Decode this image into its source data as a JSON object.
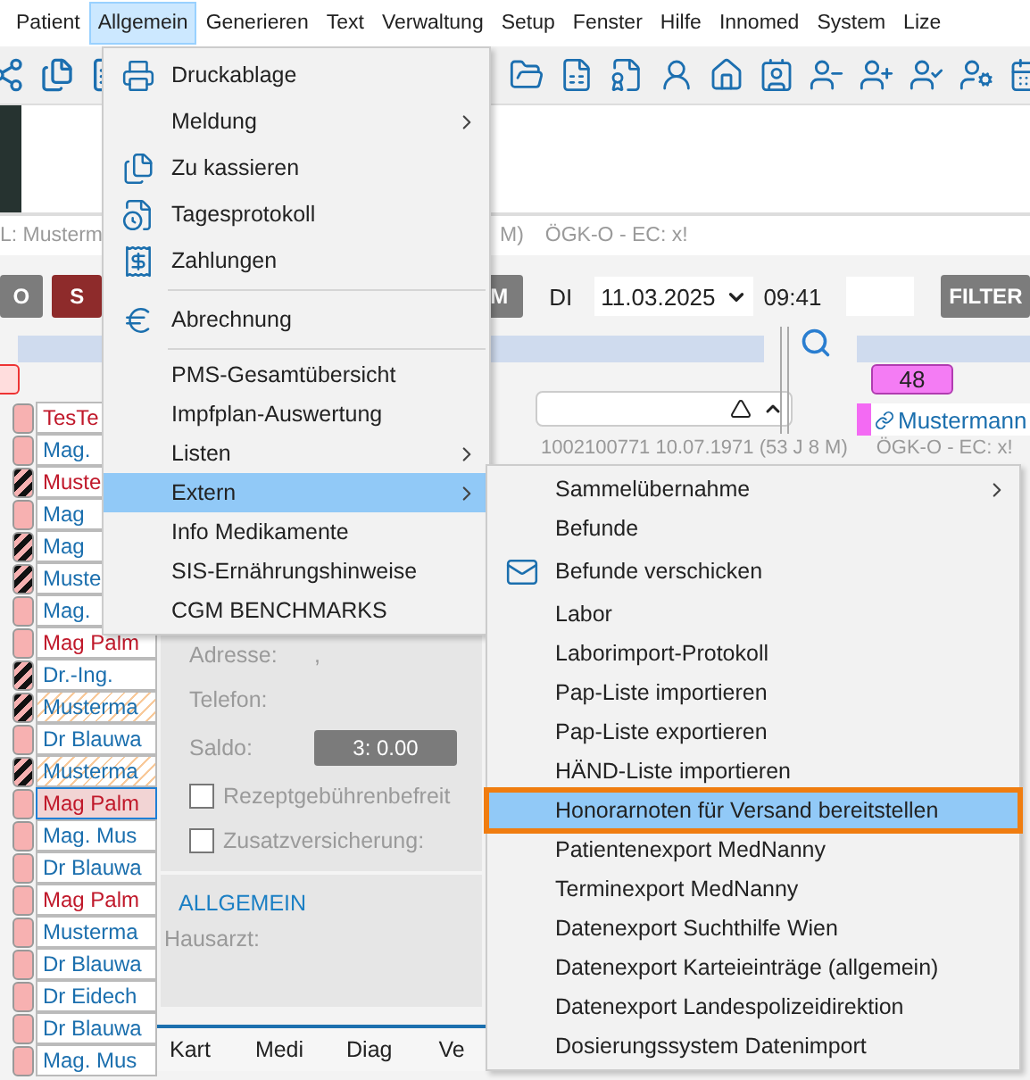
{
  "menubar": [
    {
      "label": "Patient",
      "selected": false
    },
    {
      "label": "Allgemein",
      "selected": true
    },
    {
      "label": "Generieren",
      "selected": false
    },
    {
      "label": "Text",
      "selected": false
    },
    {
      "label": "Verwaltung",
      "selected": false
    },
    {
      "label": "Setup",
      "selected": false
    },
    {
      "label": "Fenster",
      "selected": false
    },
    {
      "label": "Hilfe",
      "selected": false
    },
    {
      "label": "Innomed",
      "selected": false
    },
    {
      "label": "System",
      "selected": false
    },
    {
      "label": "Lize",
      "selected": false
    }
  ],
  "info_line": {
    "left": "L: Musterm",
    "middle": "M)",
    "right": "ÖGK-O - EC: x!"
  },
  "actions": {
    "button_1": "O",
    "button_2": "S",
    "button_3": "M",
    "weekday": "DI",
    "date": "11.03.2025",
    "time": "09:41",
    "filter": "FILTER"
  },
  "patients": [
    {
      "name": "TesTe",
      "color": "#c0182a",
      "striped": false,
      "hatched": false,
      "selected": false
    },
    {
      "name": "Mag.",
      "color": "#1b6fae",
      "striped": false,
      "hatched": false,
      "selected": false
    },
    {
      "name": "Muste",
      "color": "#c0182a",
      "striped": true,
      "hatched": false,
      "selected": false
    },
    {
      "name": "Mag",
      "color": "#1b6fae",
      "striped": false,
      "hatched": false,
      "selected": false
    },
    {
      "name": "Mag",
      "color": "#1b6fae",
      "striped": true,
      "hatched": false,
      "selected": false
    },
    {
      "name": "Muste",
      "color": "#1b6fae",
      "striped": true,
      "hatched": false,
      "selected": false
    },
    {
      "name": "Mag.",
      "color": "#1b6fae",
      "striped": false,
      "hatched": false,
      "selected": false
    },
    {
      "name": "Mag Palm",
      "color": "#c0182a",
      "striped": false,
      "hatched": false,
      "selected": false
    },
    {
      "name": "Dr.-Ing.",
      "color": "#1b6fae",
      "striped": true,
      "hatched": false,
      "selected": false
    },
    {
      "name": "Musterma",
      "color": "#1b6fae",
      "striped": true,
      "hatched": true,
      "selected": false
    },
    {
      "name": "Dr Blauwa",
      "color": "#1b6fae",
      "striped": false,
      "hatched": false,
      "selected": false
    },
    {
      "name": "Musterma",
      "color": "#1b6fae",
      "striped": true,
      "hatched": true,
      "selected": false
    },
    {
      "name": "Mag Palm",
      "color": "#c0182a",
      "striped": false,
      "hatched": false,
      "selected": true
    },
    {
      "name": "Mag. Mus",
      "color": "#1b6fae",
      "striped": false,
      "hatched": false,
      "selected": false
    },
    {
      "name": "Dr Blauwa",
      "color": "#1b6fae",
      "striped": false,
      "hatched": false,
      "selected": false
    },
    {
      "name": "Mag Palm",
      "color": "#c0182a",
      "striped": false,
      "hatched": false,
      "selected": false
    },
    {
      "name": "Musterma",
      "color": "#1b6fae",
      "striped": false,
      "hatched": false,
      "selected": false
    },
    {
      "name": "Dr Blauwa",
      "color": "#1b6fae",
      "striped": false,
      "hatched": false,
      "selected": false
    },
    {
      "name": "Dr Eidech",
      "color": "#1b6fae",
      "striped": false,
      "hatched": false,
      "selected": false
    },
    {
      "name": "Dr Blauwa",
      "color": "#1b6fae",
      "striped": false,
      "hatched": false,
      "selected": false
    },
    {
      "name": "Mag. Mus",
      "color": "#1b6fae",
      "striped": false,
      "hatched": false,
      "selected": false
    }
  ],
  "record": {
    "id_line": "1002100771 10.07.1971 (53 J 8 M)",
    "insurance": "ÖGK-O - EC: x!"
  },
  "waiting": {
    "count": "48",
    "name": "Mustermann"
  },
  "details": {
    "address_label": "Adresse:",
    "address_value": ",",
    "phone_label": "Telefon:",
    "balance_label": "Saldo:",
    "balance_value": "3: 0.00",
    "checkboxes": [
      {
        "label": "Rezeptgebührenbefreit",
        "checked": false
      },
      {
        "label": "Zusatzversicherung:",
        "checked": false
      }
    ],
    "section": "ALLGEMEIN",
    "doctor_label": "Hausarzt:"
  },
  "bottom_tabs": [
    "Kart",
    "Medi",
    "Diag",
    "Ve"
  ],
  "menu": [
    {
      "kind": "item",
      "label": "Druckablage",
      "submenu": false,
      "selected": false
    },
    {
      "kind": "item",
      "label": "Meldung",
      "submenu": true,
      "selected": false
    },
    {
      "kind": "item",
      "label": "Zu kassieren",
      "submenu": false,
      "selected": false
    },
    {
      "kind": "item",
      "label": "Tagesprotokoll",
      "submenu": false,
      "selected": false
    },
    {
      "kind": "item",
      "label": "Zahlungen",
      "submenu": false,
      "selected": false
    },
    {
      "kind": "separator"
    },
    {
      "kind": "item",
      "label": "Abrechnung",
      "submenu": false,
      "selected": false
    },
    {
      "kind": "separator"
    },
    {
      "kind": "item",
      "label": "PMS-Gesamtübersicht",
      "submenu": false,
      "selected": false
    },
    {
      "kind": "item",
      "label": "Impfplan-Auswertung",
      "submenu": false,
      "selected": false
    },
    {
      "kind": "item",
      "label": "Listen",
      "submenu": true,
      "selected": false
    },
    {
      "kind": "item",
      "label": "Extern",
      "submenu": true,
      "selected": true
    },
    {
      "kind": "item",
      "label": "Info Medikamente",
      "submenu": false,
      "selected": false
    },
    {
      "kind": "item",
      "label": "SIS-Ernährungshinweise",
      "submenu": false,
      "selected": false
    },
    {
      "kind": "item",
      "label": "CGM BENCHMARKS",
      "submenu": false,
      "selected": false
    }
  ],
  "submenu": [
    {
      "kind": "item",
      "label": "Sammelübernahme",
      "submenu": true,
      "selected": false,
      "outlined": false
    },
    {
      "kind": "item",
      "label": "Befunde",
      "submenu": false,
      "selected": false,
      "outlined": false
    },
    {
      "kind": "item",
      "label": "Befunde verschicken",
      "submenu": false,
      "selected": false,
      "outlined": false
    },
    {
      "kind": "item",
      "label": "Labor",
      "submenu": false,
      "selected": false,
      "outlined": false
    },
    {
      "kind": "item",
      "label": "Laborimport-Protokoll",
      "submenu": false,
      "selected": false,
      "outlined": false
    },
    {
      "kind": "item",
      "label": "Pap-Liste importieren",
      "submenu": false,
      "selected": false,
      "outlined": false
    },
    {
      "kind": "item",
      "label": "Pap-Liste exportieren",
      "submenu": false,
      "selected": false,
      "outlined": false
    },
    {
      "kind": "item",
      "label": "HÄND-Liste importieren",
      "submenu": false,
      "selected": false,
      "outlined": false
    },
    {
      "kind": "item",
      "label": "Honorarnoten für Versand bereitstellen",
      "submenu": false,
      "selected": true,
      "outlined": true
    },
    {
      "kind": "item",
      "label": "Patientenexport MedNanny",
      "submenu": false,
      "selected": false,
      "outlined": false
    },
    {
      "kind": "item",
      "label": "Terminexport MedNanny",
      "submenu": false,
      "selected": false,
      "outlined": false
    },
    {
      "kind": "item",
      "label": "Datenexport Suchthilfe Wien",
      "submenu": false,
      "selected": false,
      "outlined": false
    },
    {
      "kind": "item",
      "label": "Datenexport Karteieinträge (allgemein)",
      "submenu": false,
      "selected": false,
      "outlined": false
    },
    {
      "kind": "item",
      "label": "Datenexport Landespolizeidirektion",
      "submenu": false,
      "selected": false,
      "outlined": false
    },
    {
      "kind": "item",
      "label": "Dosierungssystem Datenimport",
      "submenu": false,
      "selected": false,
      "outlined": false
    }
  ]
}
